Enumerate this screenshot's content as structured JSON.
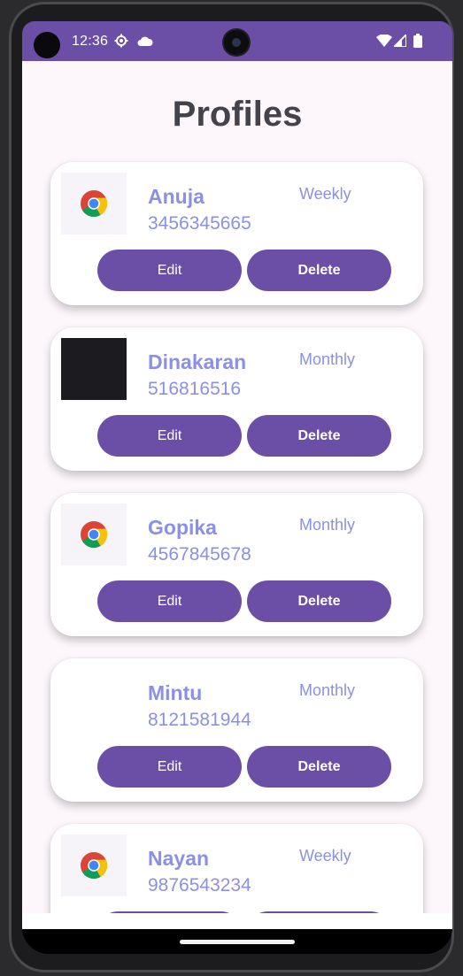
{
  "status_bar": {
    "time": "12:36",
    "icons": [
      "settings-icon",
      "cloud-icon",
      "wifi-icon",
      "signal-icon",
      "battery-icon"
    ]
  },
  "page": {
    "title": "Profiles"
  },
  "buttons": {
    "edit_label": "Edit",
    "delete_label": "Delete"
  },
  "profiles": [
    {
      "name": "Anuja",
      "phone": "3456345665",
      "plan": "Weekly",
      "avatar": "chrome-icon"
    },
    {
      "name": "Dinakaran",
      "phone": "516816516",
      "plan": "Monthly",
      "avatar": "dark-image"
    },
    {
      "name": "Gopika",
      "phone": "4567845678",
      "plan": "Monthly",
      "avatar": "chrome-icon"
    },
    {
      "name": "Mintu",
      "phone": "8121581944",
      "plan": "Monthly",
      "avatar": "none"
    },
    {
      "name": "Nayan",
      "phone": "9876543234",
      "plan": "Weekly",
      "avatar": "chrome-icon"
    }
  ],
  "colors": {
    "primary": "#6b4fa6",
    "accent_text": "#8c8fe6",
    "background": "#fdf7fc"
  }
}
